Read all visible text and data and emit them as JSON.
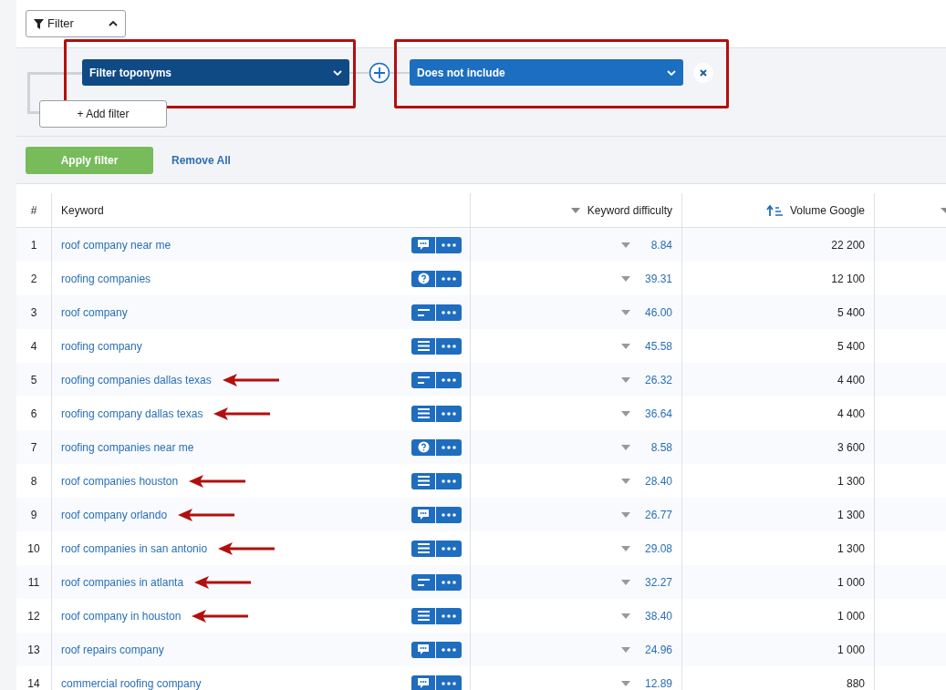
{
  "filter_toggle": {
    "label": "Filter",
    "expanded": true
  },
  "filters": [
    {
      "kind": "field",
      "label": "Filter toponyms",
      "highlighted": true
    },
    {
      "kind": "operator",
      "label": "Does not include",
      "highlighted": true
    }
  ],
  "add_filter": "+ Add filter",
  "apply_button": "Apply filter",
  "remove_all": "Remove All",
  "table": {
    "columns": [
      {
        "label": "#"
      },
      {
        "label": "Keyword"
      },
      {
        "label": "Keyword difficulty",
        "kind": "sortable"
      },
      {
        "label": "Volume Google",
        "kind": "ascending"
      }
    ],
    "rows": [
      {
        "num": "1",
        "keyword": "roof company near me",
        "kind": "chat",
        "difficulty": "8.84",
        "volume": "22 200",
        "marked": false
      },
      {
        "num": "2",
        "keyword": "roofing companies",
        "kind": "question",
        "difficulty": "39.31",
        "volume": "12 100",
        "marked": false
      },
      {
        "num": "3",
        "keyword": "roof company",
        "kind": "short",
        "difficulty": "46.00",
        "volume": "5 400",
        "marked": false
      },
      {
        "num": "4",
        "keyword": "roofing company",
        "kind": "lines",
        "difficulty": "45.58",
        "volume": "5 400",
        "marked": false
      },
      {
        "num": "5",
        "keyword": "roofing companies dallas texas",
        "kind": "short",
        "difficulty": "26.32",
        "volume": "4 400",
        "marked": true
      },
      {
        "num": "6",
        "keyword": "roofing company dallas texas",
        "kind": "lines",
        "difficulty": "36.64",
        "volume": "4 400",
        "marked": true
      },
      {
        "num": "7",
        "keyword": "roofing companies near me",
        "kind": "question",
        "difficulty": "8.58",
        "volume": "3 600",
        "marked": false
      },
      {
        "num": "8",
        "keyword": "roof companies houston",
        "kind": "lines",
        "difficulty": "28.40",
        "volume": "1 300",
        "marked": true
      },
      {
        "num": "9",
        "keyword": "roof company orlando",
        "kind": "chat",
        "difficulty": "26.77",
        "volume": "1 300",
        "marked": true
      },
      {
        "num": "10",
        "keyword": "roof companies in san antonio",
        "kind": "lines",
        "difficulty": "29.08",
        "volume": "1 300",
        "marked": true
      },
      {
        "num": "11",
        "keyword": "roof companies in atlanta",
        "kind": "short",
        "difficulty": "32.27",
        "volume": "1 000",
        "marked": true
      },
      {
        "num": "12",
        "keyword": "roof company in houston",
        "kind": "lines",
        "difficulty": "38.40",
        "volume": "1 000",
        "marked": true
      },
      {
        "num": "13",
        "keyword": "roof repairs company",
        "kind": "chat",
        "difficulty": "24.96",
        "volume": "1 000",
        "marked": false
      },
      {
        "num": "14",
        "keyword": "commercial roofing company",
        "kind": "chat",
        "difficulty": "12.89",
        "volume": "880",
        "marked": false
      }
    ]
  }
}
